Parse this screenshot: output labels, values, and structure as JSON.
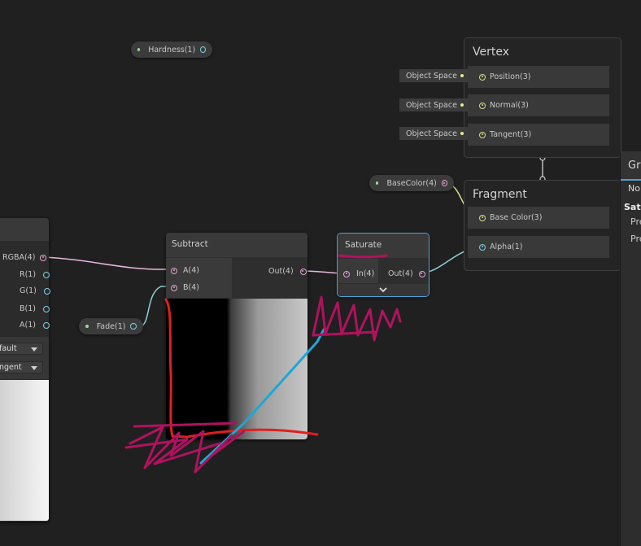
{
  "hardness_node": {
    "label": "Hardness(1)"
  },
  "vertex_context": {
    "title": "Vertex",
    "slots": [
      {
        "label": "Position(3)",
        "input": "Object Space"
      },
      {
        "label": "Normal(3)",
        "input": "Object Space"
      },
      {
        "label": "Tangent(3)",
        "input": "Object Space"
      }
    ]
  },
  "fragment_context": {
    "title": "Fragment",
    "slots": [
      {
        "label": "Base Color(3)"
      },
      {
        "label": "Alpha(1)"
      }
    ]
  },
  "basecolor_property": {
    "label": "BaseColor(4)"
  },
  "fade_property": {
    "label": "Fade(1)"
  },
  "subtract_node": {
    "title": "Subtract",
    "inputs": [
      "A(4)",
      "B(4)"
    ],
    "output": "Out(4)"
  },
  "saturate_node": {
    "title": "Saturate",
    "input": "In(4)",
    "output": "Out(4)"
  },
  "sample_node": {
    "outputs": [
      "RGBA(4)",
      "R(1)",
      "G(1)",
      "B(1)",
      "A(1)"
    ],
    "dropdowns": [
      "fault",
      "ngent"
    ]
  },
  "inspector": {
    "title": "Gra",
    "line1": "No",
    "line2": "Satu",
    "line3": "Pre",
    "line4": "Pre"
  },
  "colors": {
    "background": "#202020",
    "selection_outline": "#4da3d8",
    "annotation_red": "#e01f1f",
    "annotation_magenta": "#b0125f",
    "annotation_blue": "#1ea7d6"
  }
}
